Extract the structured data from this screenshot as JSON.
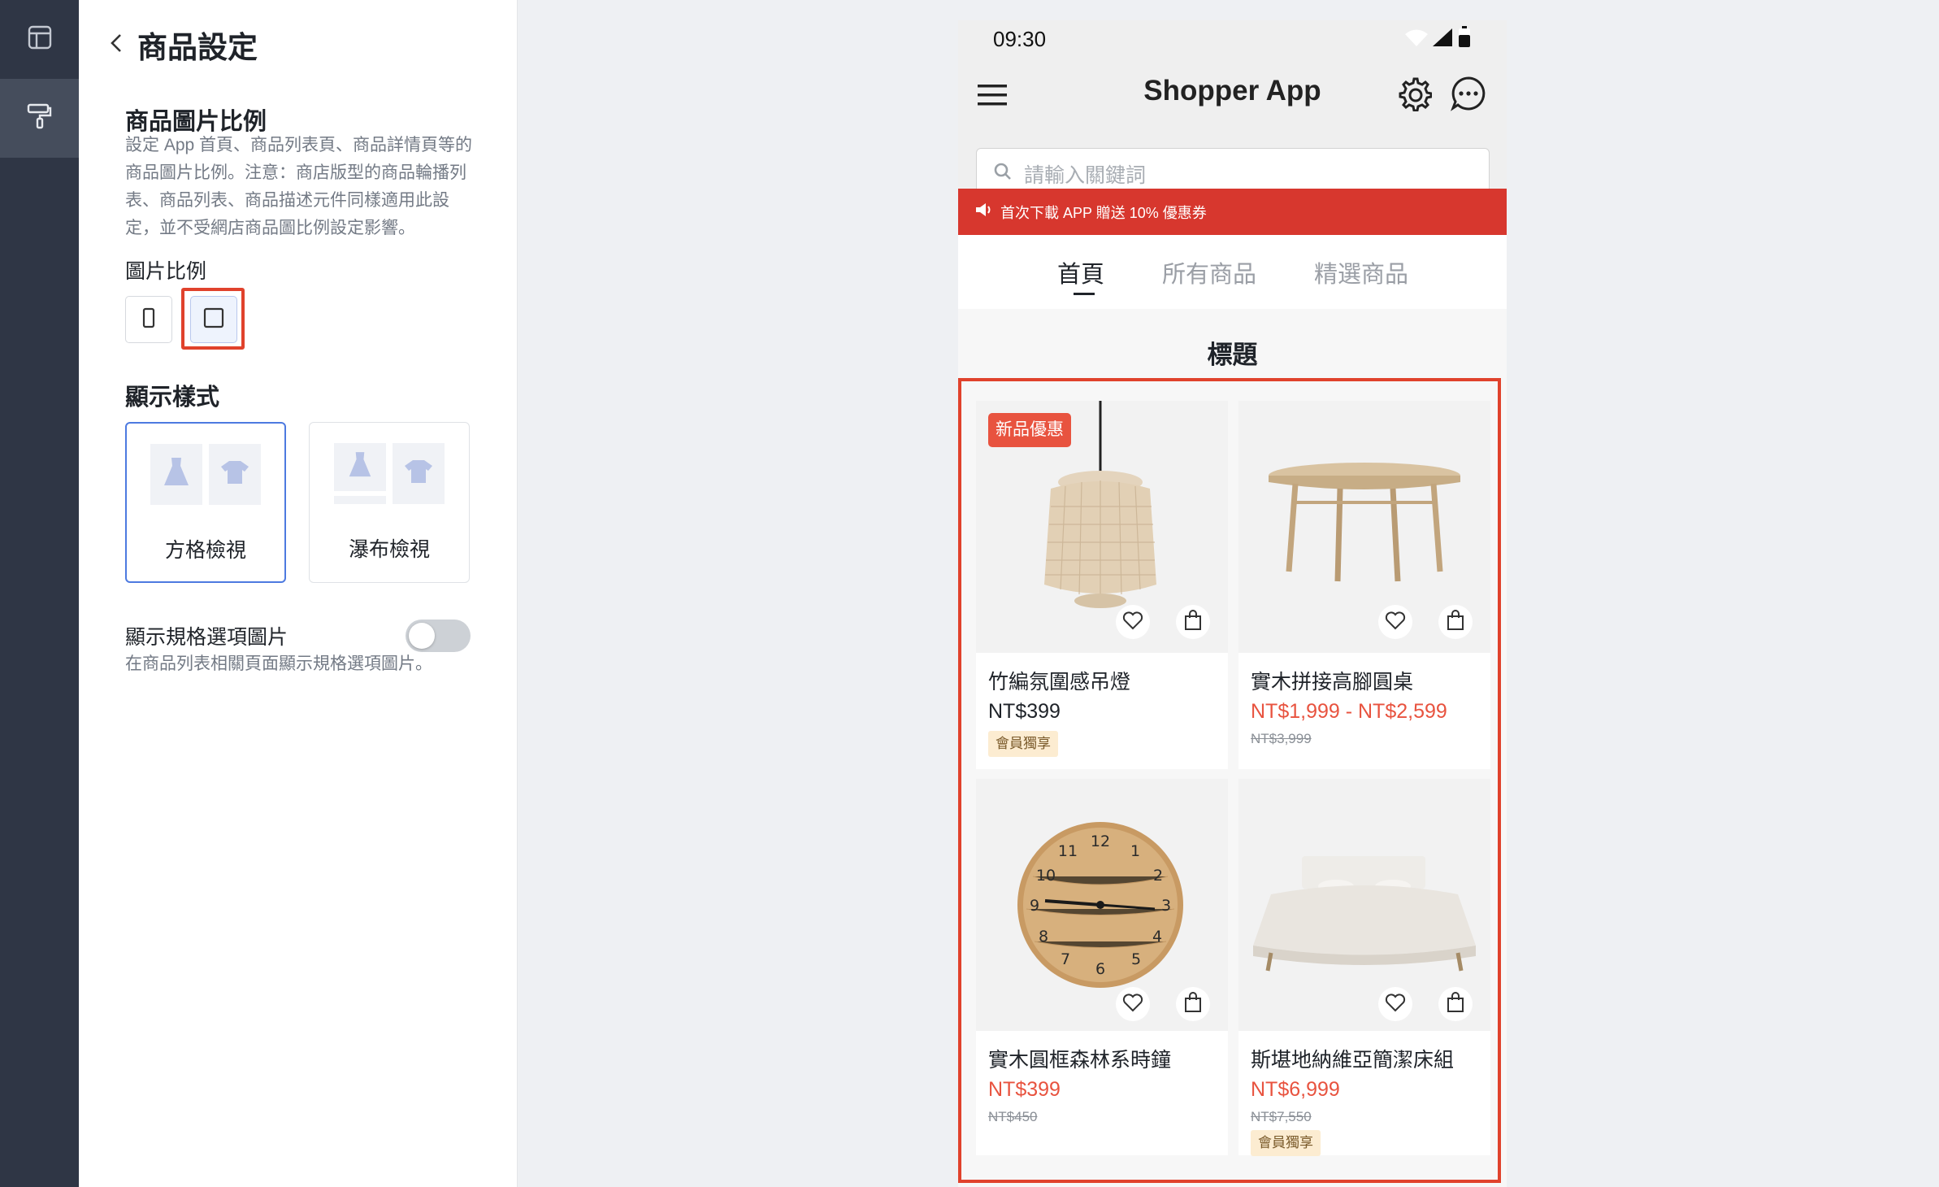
{
  "panel": {
    "title": "商品設定",
    "ratio_section": {
      "title": "商品圖片比例",
      "description": "設定 App 首頁、商品列表頁、商品詳情頁等的商品圖片比例。注意：商店版型的商品輪播列表、商品列表、商品描述元件同樣適用此設定，並不受網店商品圖比例設定影響。",
      "label": "圖片比例",
      "options": [
        "portrait-ratio",
        "square-ratio"
      ],
      "selected": "square-ratio"
    },
    "display_section": {
      "title": "顯示樣式",
      "options": [
        {
          "label": "方格檢視",
          "selected": true
        },
        {
          "label": "瀑布檢視",
          "selected": false
        }
      ]
    },
    "variant_toggle": {
      "label": "顯示規格選項圖片",
      "description": "在商品列表相關頁面顯示規格選項圖片。",
      "on": false
    }
  },
  "phone": {
    "time": "09:30",
    "app_title": "Shopper App",
    "search_placeholder": "請輸入關鍵詞",
    "banner_text": "首次下載 APP 贈送 10% 優惠券",
    "tabs": [
      "首頁",
      "所有商品",
      "精選商品"
    ],
    "active_tab": "首頁",
    "section_heading": "標題",
    "products": [
      {
        "name": "竹編氛圍感吊燈",
        "price": "NT$399",
        "on_sale": false,
        "original_price": "",
        "badge": "會員獨享",
        "promo": "新品優惠"
      },
      {
        "name": "實木拼接高腳圓桌",
        "price": "NT$1,999 - NT$2,599",
        "on_sale": true,
        "original_price": "NT$3,999",
        "badge": "",
        "promo": ""
      },
      {
        "name": "實木圓框森林系時鐘",
        "price": "NT$399",
        "on_sale": true,
        "original_price": "NT$450",
        "badge": "",
        "promo": ""
      },
      {
        "name": "斯堪地納維亞簡潔床組",
        "price": "NT$6,999",
        "on_sale": true,
        "original_price": "NT$7,550",
        "badge": "會員獨享",
        "promo": ""
      }
    ]
  },
  "colors": {
    "accent_red": "#e0422c",
    "banner_red": "#d7372e",
    "sale_price": "#e8533f",
    "selected_border": "#4d7ae0",
    "rail_bg": "#2f3645"
  }
}
